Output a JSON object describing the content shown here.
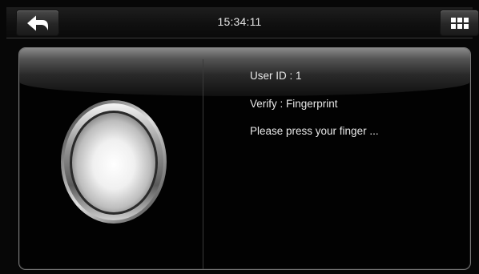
{
  "header": {
    "time": "15:34:11",
    "back_icon": "back-arrow-icon",
    "menu_icon": "grid-menu-icon"
  },
  "verify": {
    "user_id_line": "User ID : 1",
    "verify_line": "Verify : Fingerprint",
    "prompt_line": "Please press your finger ..."
  },
  "colors": {
    "background": "#070707",
    "text": "#e8e8e8",
    "panel_border": "#777777"
  }
}
